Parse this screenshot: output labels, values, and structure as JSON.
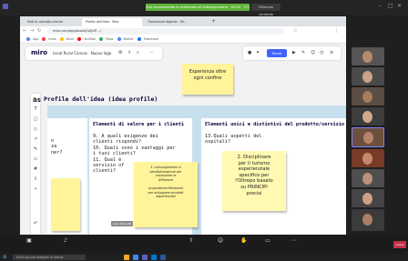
{
  "meeting": {
    "share_banner": "Stai visualizzando la schermata di Sottosegretario · 00:00 · 17:00",
    "stop_share_label": "Rinuncia controllo",
    "window_controls": [
      "–",
      "□",
      "✕"
    ]
  },
  "browser": {
    "tabs": [
      {
        "label": "Dati di contatto cliente"
      },
      {
        "label": "Profilo dell'idea · Miro"
      },
      {
        "label": "Transizione digitale · Mi..."
      }
    ],
    "address": "miro.com/app/board/uXjVP..../",
    "bookmarks": [
      "App",
      "Inizio",
      "Drive",
      "YouTube",
      "Maps",
      "Notizie",
      "Traduttore"
    ]
  },
  "miro": {
    "logo": "miro",
    "board_name": "Local Rural Canvas · Nuovo lago",
    "share_label": "Share",
    "frame_label": "Profile dell'idea (idea profile)",
    "left_cut_label": "as",
    "columns": [
      {
        "title": "",
        "body": "o\nza\nner?"
      },
      {
        "title": "Elementi di valore per i\nclienti",
        "body": "9. A quali esigenze dei\nclienti rispondi?\n10. Quali sono i vantaggi per\ni tuoi clienti?\n11. Qual è\nservizio of\nclienti?"
      },
      {
        "title": "Elementi unici e distintivi\ndel prodotto/servizio",
        "body": "13.Quali aspetti del\nospitali?"
      }
    ],
    "stickies": [
      {
        "text": "Esperienza oltre\nogni confine"
      },
      {
        "text": "2. Disciplinare\nper il turismo\nesperienziale\nspecifico per\nl'Oltrepo basato\nsu PRINCIPI\nprecisi"
      },
      {
        "text": "3. coinvolgimento e\nsensibilizzazione per\nvalorizzare le\nAffluenze\n\nproposte/certificazioni\nper sviluppare prodotti\nesperienziali"
      },
      {
        "text": ""
      }
    ],
    "cursor_tag": "Luca Rossetti"
  },
  "participants": [
    {
      "name": ""
    },
    {
      "name": ""
    },
    {
      "name": ""
    },
    {
      "name": ""
    },
    {
      "name": ""
    },
    {
      "name": ""
    },
    {
      "name": ""
    },
    {
      "name": ""
    },
    {
      "name": ""
    }
  ],
  "call_bar": {
    "buttons": [
      {
        "icon": "video-icon",
        "label": ""
      },
      {
        "icon": "mic-icon",
        "label": ""
      },
      {
        "icon": "share-icon",
        "label": ""
      },
      {
        "icon": "reactions-icon",
        "label": ""
      },
      {
        "icon": "raise-hand-icon",
        "label": ""
      },
      {
        "icon": "chat-icon",
        "label": ""
      },
      {
        "icon": "more-icon",
        "label": ""
      }
    ],
    "leave_label": "Leave"
  },
  "taskbar": {
    "search_placeholder": "Scrivi qui per eseguire la ricerca",
    "clock": ""
  },
  "colors": {
    "miro_blue": "#4262ff",
    "sticky_yellow": "#fff49a",
    "frame_blue": "#c8e0ee",
    "share_green": "#5fb33a",
    "leave_red": "#c4314b"
  }
}
